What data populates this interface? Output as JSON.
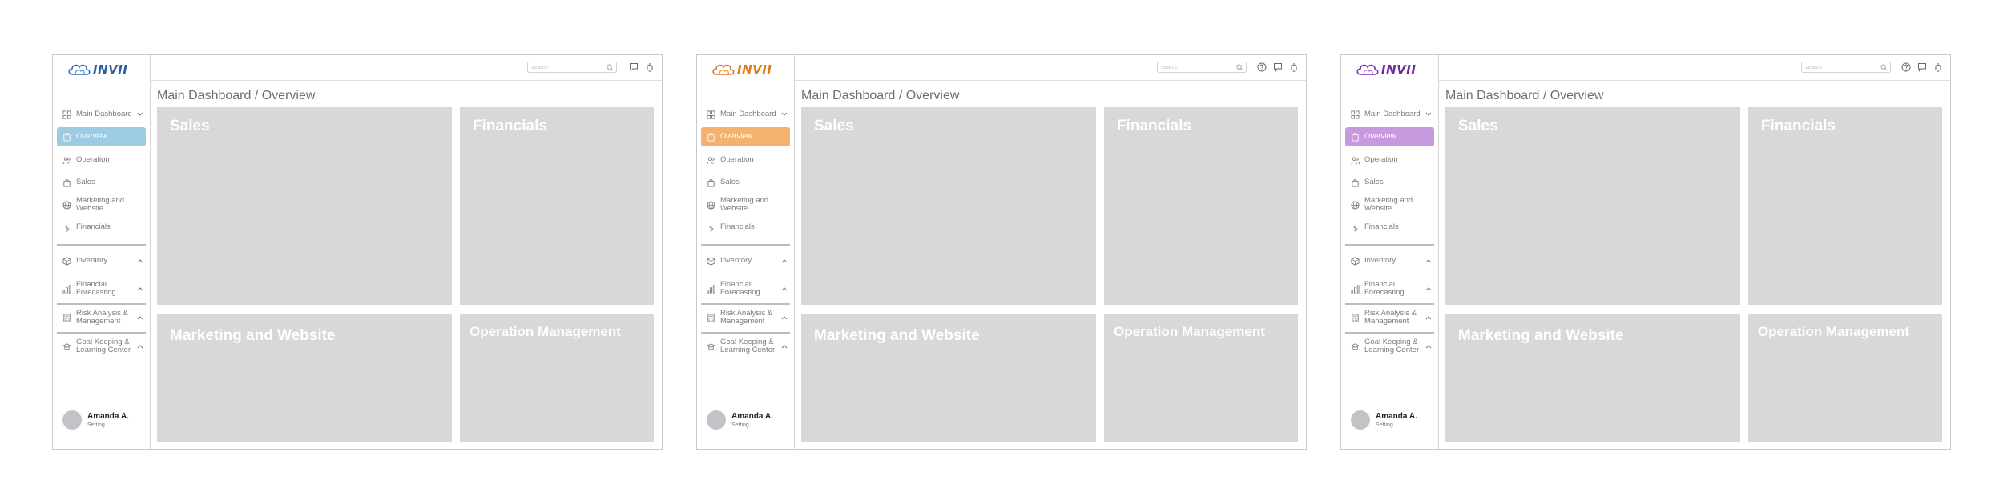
{
  "variants": [
    {
      "theme": "blue",
      "accent": "#9ccbe3",
      "logo_stroke": "#2f6fb7",
      "logo_fill": "#4fa9d8",
      "logo_text_color": "#2b5ea8",
      "show_help_icon": false
    },
    {
      "theme": "orange",
      "accent": "#f4b26c",
      "logo_stroke": "#e36a1e",
      "logo_fill": "#f6a23a",
      "logo_text_color": "#e07a14",
      "show_help_icon": true
    },
    {
      "theme": "purple",
      "accent": "#c79ae0",
      "logo_stroke": "#7a2fb0",
      "logo_fill": "#b57ad8",
      "logo_text_color": "#6a2aa3",
      "show_help_icon": true
    }
  ],
  "brand": {
    "name": "INVII"
  },
  "search": {
    "placeholder": "search"
  },
  "nav": {
    "main_dashboard": "Main Dashboard",
    "overview": "Overview",
    "operation": "Operation",
    "sales": "Sales",
    "marketing_line1": "Marketing and",
    "marketing_line2": "Website",
    "financials": "Financials",
    "inventory": "Inventory",
    "forecast_line1": "Financial",
    "forecast_line2": "Forecasting",
    "risk_line1": "Risk Analysis &",
    "risk_line2": "Management",
    "goal_line1": "Goal Keeping &",
    "goal_line2": "Learning Center"
  },
  "user": {
    "name": "Amanda A.",
    "subtitle": "Setting"
  },
  "page": {
    "breadcrumb": "Main Dashboard / Overview"
  },
  "cards": {
    "sales": "Sales",
    "financials": "Financials",
    "marketing": "Marketing and Website",
    "operation": "Operation Management"
  },
  "icons": {
    "search": "search-icon",
    "help": "help-icon",
    "chat": "chat-icon",
    "bell": "bell-icon"
  }
}
